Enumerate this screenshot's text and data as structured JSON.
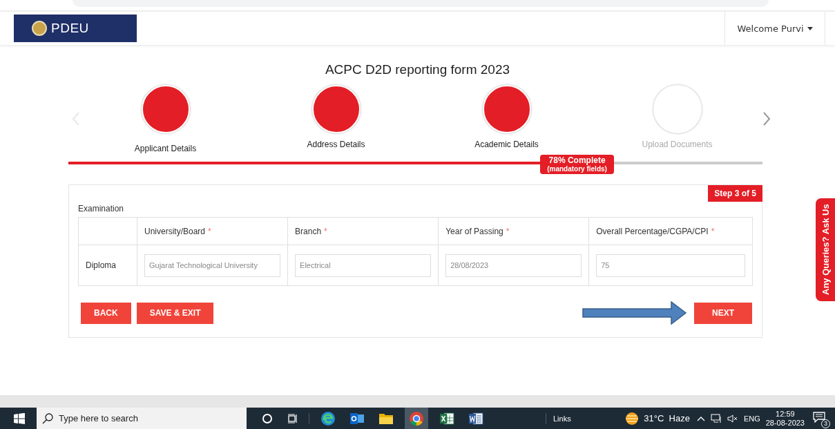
{
  "header": {
    "logo_text": "PDEU",
    "user_menu": "Welcome Purvi"
  },
  "title": "ACPC D2D reporting form 2023",
  "steps": [
    {
      "label": "Applicant Details",
      "completed": true
    },
    {
      "label": "Address Details",
      "completed": true
    },
    {
      "label": "Academic Details",
      "completed": true
    },
    {
      "label": "Upload Documents",
      "completed": false
    }
  ],
  "progress": {
    "level": 0.78,
    "label": "78% Complete",
    "sublabel": "(mandatory fields)"
  },
  "step_badge": "Step 3 of 5",
  "section_label": "Examination",
  "table": {
    "columns": [
      {
        "label": "University/Board",
        "required_mark": "*"
      },
      {
        "label": "Branch",
        "required_mark": "*"
      },
      {
        "label": "Year of Passing",
        "required_mark": "*"
      },
      {
        "label": "Overall Percentage/CGPA/CPI",
        "required_mark": "*"
      }
    ],
    "rows": [
      {
        "label": "Diploma",
        "values": [
          "Gujarat Technological University",
          "Electrical",
          "28/08/2023",
          "75"
        ]
      }
    ]
  },
  "buttons": {
    "back": "BACK",
    "save": "SAVE & EXIT",
    "next": "NEXT"
  },
  "side_tab": "Any Queries? Ask Us",
  "taskbar": {
    "search_placeholder": "Type here to search",
    "links": "Links",
    "weather": "31°C  Haze",
    "language": "ENG",
    "time": "12:59",
    "date": "28-08-2023",
    "notifications": "3"
  }
}
